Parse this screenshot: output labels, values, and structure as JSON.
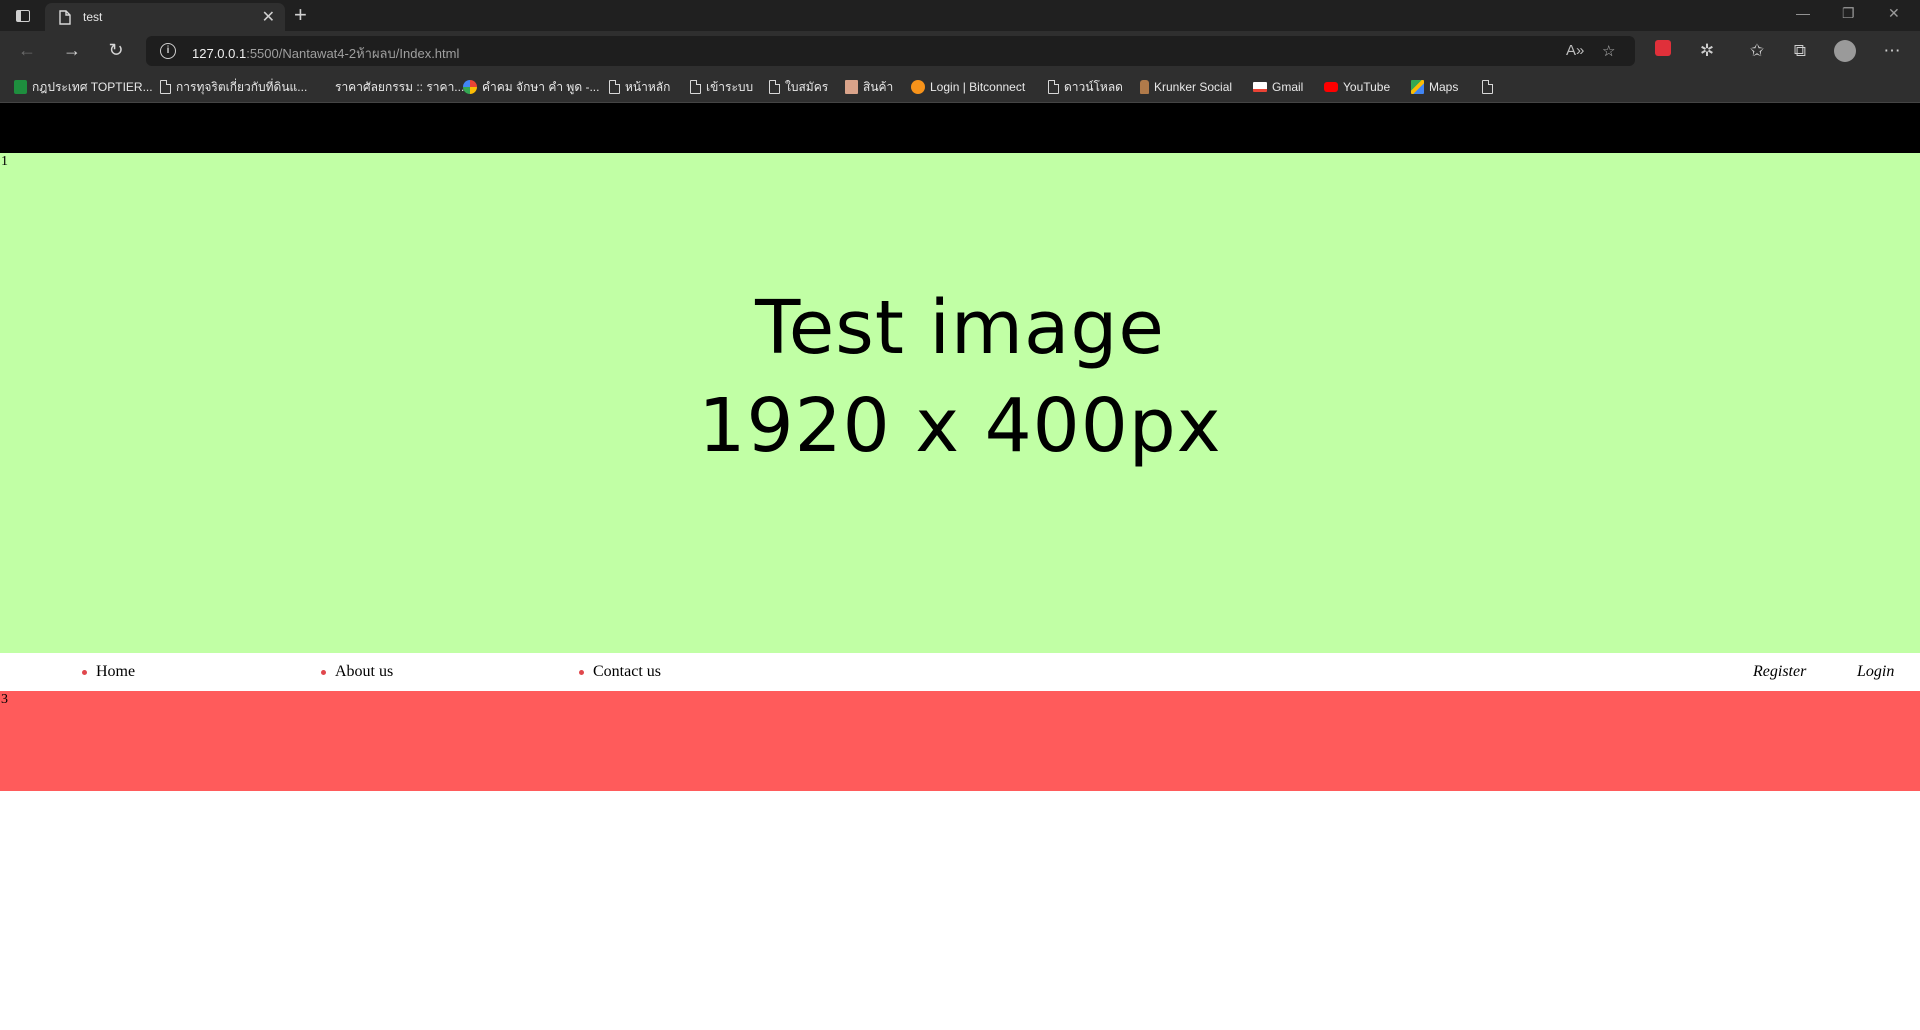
{
  "browser": {
    "tab_title": "test",
    "url_host": "127.0.0.1",
    "url_path": ":5500/Nantawat4-2ห้าผลบ/Index.html",
    "bookmarks": [
      {
        "label": "กฎประเทศ TOPTIER...",
        "icon": "green-sheet-icon"
      },
      {
        "label": "การทุจริตเกี่ยวกับที่ดินแ...",
        "icon": "page-icon"
      },
      {
        "label": "ราคาศัลยกรรม :: ราคา...",
        "icon": "none"
      },
      {
        "label": "คำคม จักษา คำ พูด -...",
        "icon": "google-icon"
      },
      {
        "label": "หน้าหลัก",
        "icon": "page-icon"
      },
      {
        "label": "เข้าระบบ",
        "icon": "page-icon"
      },
      {
        "label": "ใบสมัคร",
        "icon": "page-icon"
      },
      {
        "label": "สินค้า",
        "icon": "shop-icon"
      },
      {
        "label": "Login | Bitconnect",
        "icon": "bitconnect-icon"
      },
      {
        "label": "ดาวน์โหลด",
        "icon": "page-icon"
      },
      {
        "label": "Krunker Social",
        "icon": "krunker-icon"
      },
      {
        "label": "Gmail",
        "icon": "gmail-icon"
      },
      {
        "label": "YouTube",
        "icon": "youtube-icon"
      },
      {
        "label": "Maps",
        "icon": "maps-icon"
      },
      {
        "label": "",
        "icon": "page-icon"
      }
    ]
  },
  "page": {
    "section1_number": "1",
    "hero_line1": "Test image",
    "hero_line2": "1920 x 400px",
    "section3_number": "3",
    "menu": {
      "left_items": [
        "Home",
        "About us",
        "Contact us"
      ],
      "register": "Register",
      "login": "Login"
    }
  },
  "colors": {
    "top_bar": "#000000",
    "hero_bg": "#c1ffa5",
    "menu_bullet": "#e0474c",
    "red_band": "#ff5b5b"
  }
}
